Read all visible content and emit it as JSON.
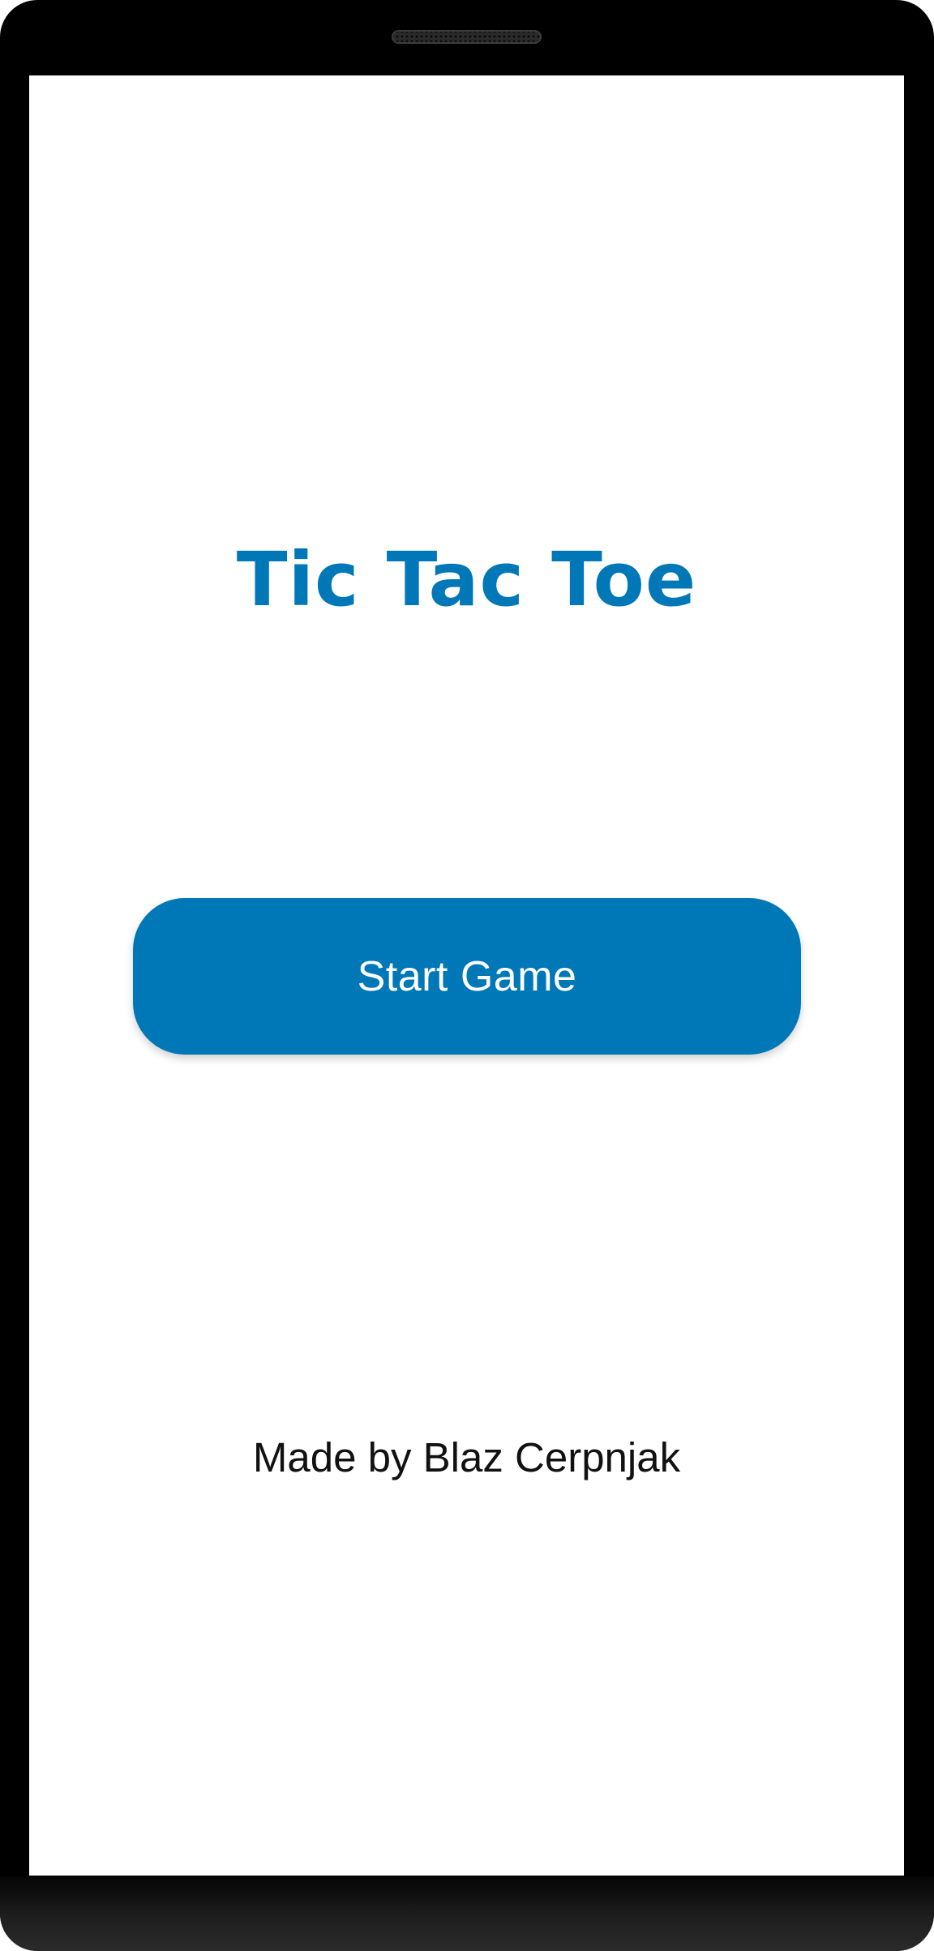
{
  "app": {
    "title": "Tic Tac Toe"
  },
  "main": {
    "start_button_label": "Start Game",
    "credit": "Made by Blaz Cerpnjak"
  },
  "colors": {
    "accent": "#0077b6",
    "button_text": "#ffffff",
    "background": "#ffffff",
    "frame": "#000000"
  },
  "icons": {
    "speaker": "speaker-grille-icon"
  }
}
